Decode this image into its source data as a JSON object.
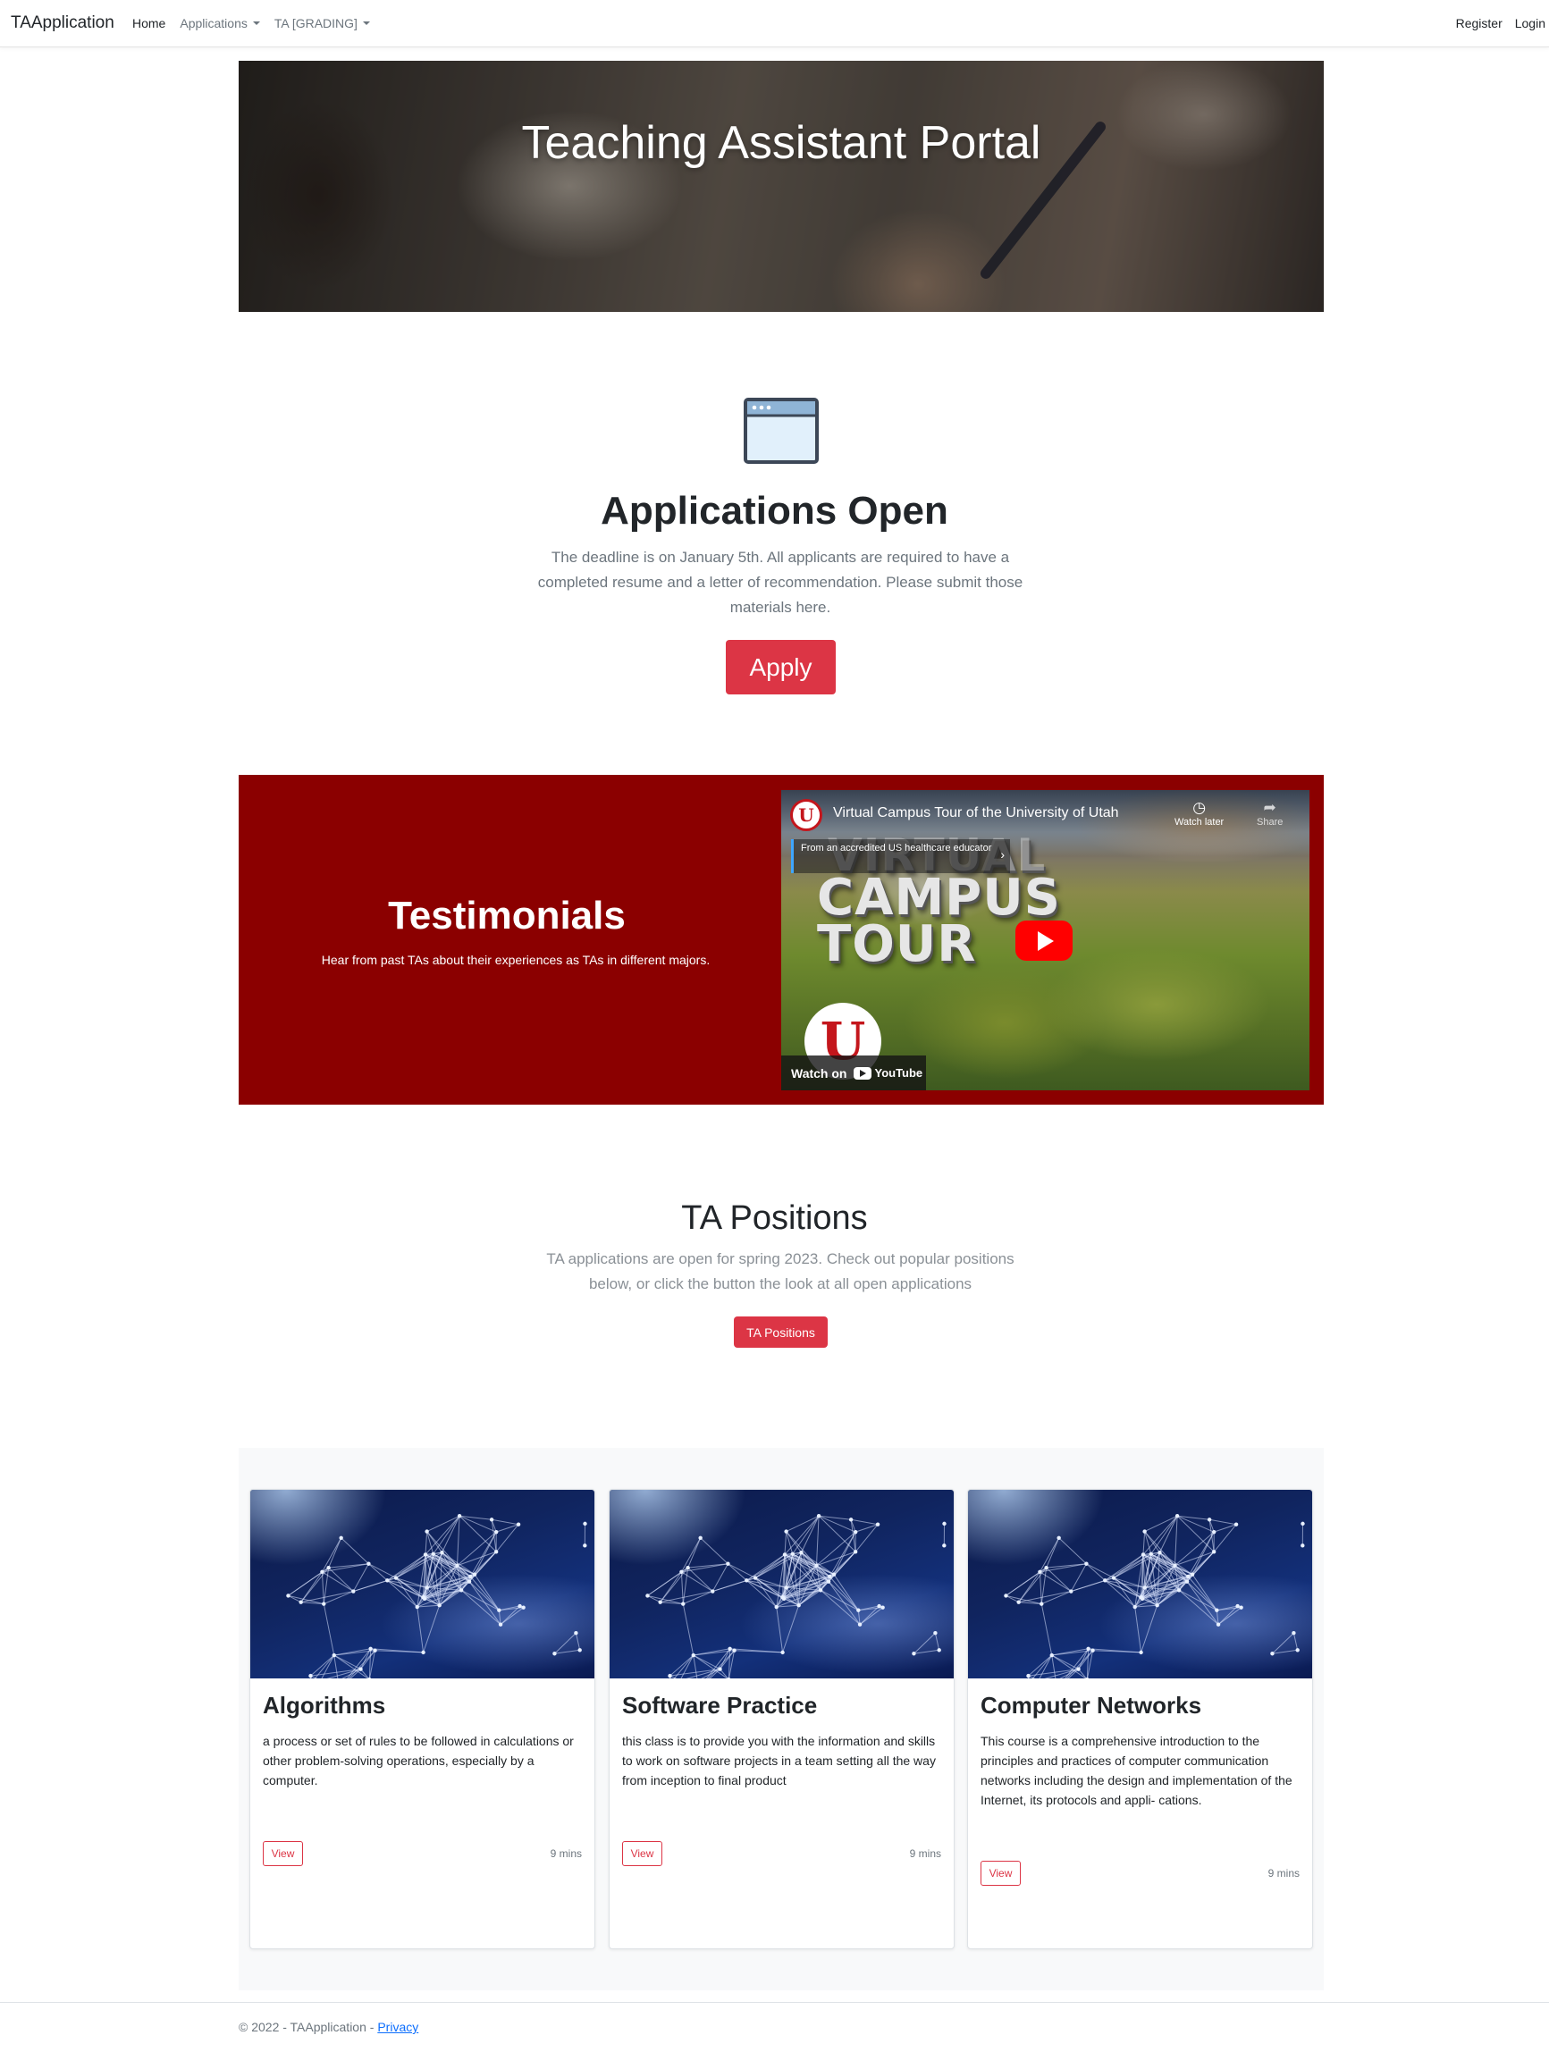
{
  "navbar": {
    "brand": "TAApplication",
    "links": [
      {
        "label": "Home"
      },
      {
        "label": "Applications"
      },
      {
        "label": "TA [GRADING]"
      }
    ],
    "right_links": [
      {
        "label": "Register"
      },
      {
        "label": "Login"
      }
    ]
  },
  "hero": {
    "title": "Teaching Assistant Portal"
  },
  "applications": {
    "icon": "browser-window-icon",
    "title": "Applications Open",
    "text": "The deadline is on January 5th. All applicants are required to have a completed resume and a letter of recommendation. Please submit those materials here.",
    "button": "Apply"
  },
  "testimonials": {
    "title": "Testimonials",
    "subtitle": "Hear from past TAs about their experiences as TAs in different majors.",
    "video": {
      "title": "Virtual Campus Tour of the University of Utah",
      "watch_later": "Watch later",
      "share": "Share",
      "banner": "From an accredited US healthcare educator",
      "overlay_line1": "VIRTUAL",
      "overlay_line2": "CAMPUS",
      "overlay_line3": "TOUR",
      "watch_on": "Watch on",
      "youtube": "YouTube",
      "logo_letter": "U"
    }
  },
  "positions": {
    "title": "TA Positions",
    "text": "TA applications are open for spring 2023. Check out popular positions below, or click the button the look at all open applications",
    "button": "TA Positions"
  },
  "cards": [
    {
      "title": "Algorithms",
      "text": "a process or set of rules to be followed in calculations or other problem-solving operations, especially by a computer.",
      "button": "View",
      "meta": "9 mins"
    },
    {
      "title": "Software Practice",
      "text": "this class is to provide you with the information and skills to work on software projects in a team setting all the way from inception to final product",
      "button": "View",
      "meta": "9 mins"
    },
    {
      "title": "Computer Networks",
      "text": "This course is a comprehensive introduction to the principles and practices of computer communication networks including the design and implementation of the Internet, its protocols and appli- cations.",
      "button": "View",
      "meta": "9 mins"
    }
  ],
  "footer": {
    "copyright": "© 2022 - TAApplication - ",
    "privacy": "Privacy"
  },
  "colors": {
    "accent": "#dc3545",
    "testimonials_bg": "#8b0000"
  }
}
